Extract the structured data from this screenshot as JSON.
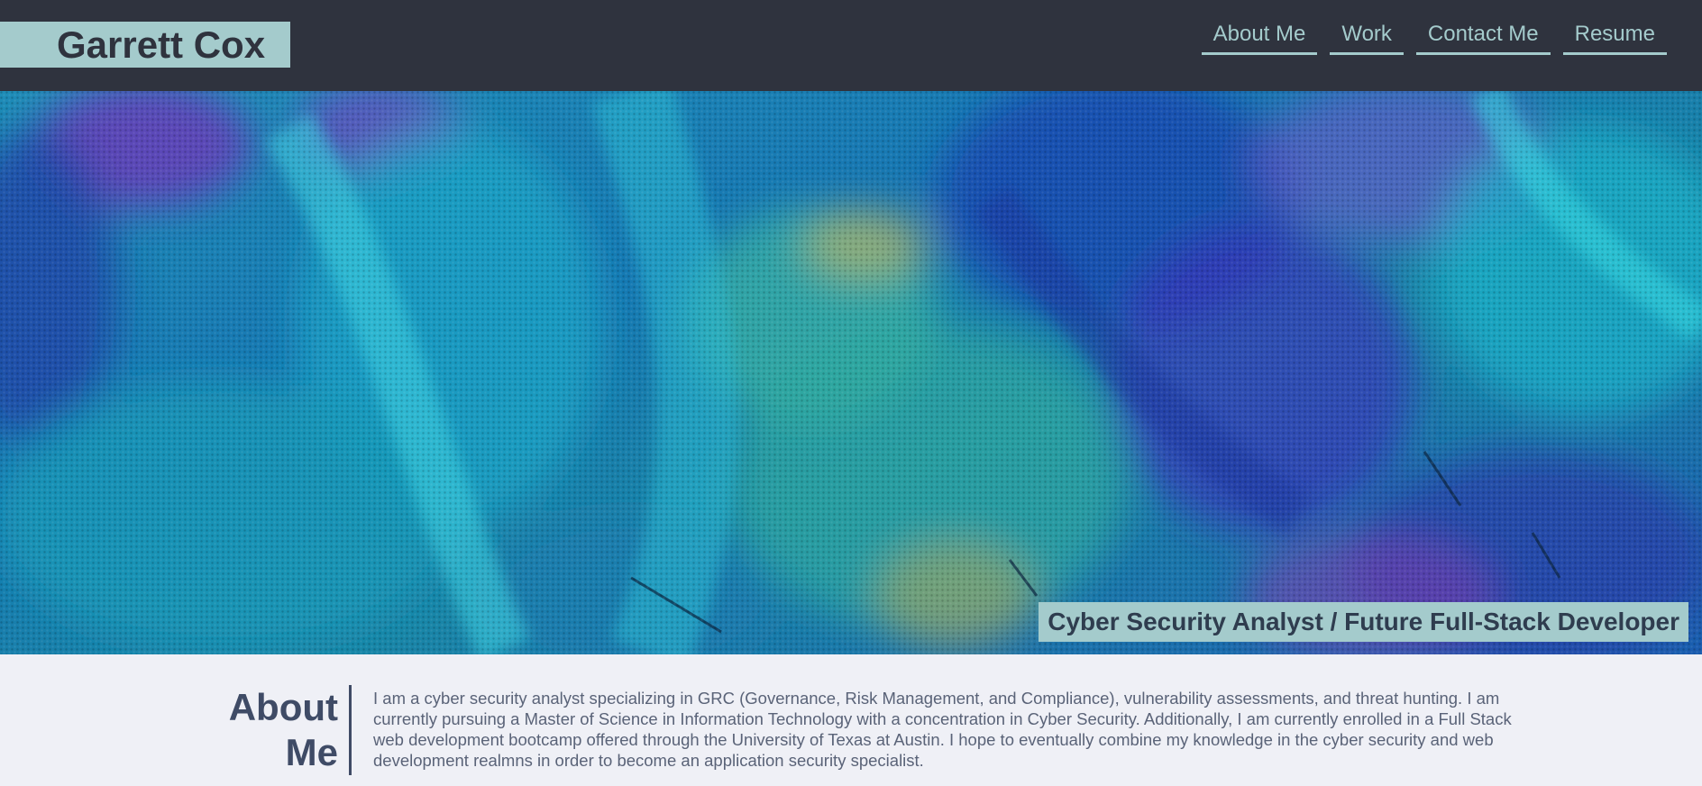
{
  "header": {
    "brand": "Garrett Cox",
    "nav": [
      {
        "label": "About Me"
      },
      {
        "label": "Work"
      },
      {
        "label": "Contact Me"
      },
      {
        "label": "Resume"
      }
    ]
  },
  "hero": {
    "tagline": "Cyber Security Analyst / Future Full-Stack Developer"
  },
  "about": {
    "heading": "About Me",
    "text": "I am a cyber security analyst specializing in GRC (Governance, Risk Management, and Compliance), vulnerability assessments, and threat hunting. I am currently pursuing a Master of Science in Information Technology with a concentration in Cyber Security. Additionally, I am currently enrolled in a Full Stack web development bootcamp offered through the University of Texas at Austin. I hope to eventually combine my knowledge in the cyber security and web development realmns in order to become an application security specialist."
  },
  "colors": {
    "header_bg": "#2f333e",
    "accent": "#a4cbcc",
    "page_bg": "#eff0f6",
    "text": "#3f4b66"
  }
}
